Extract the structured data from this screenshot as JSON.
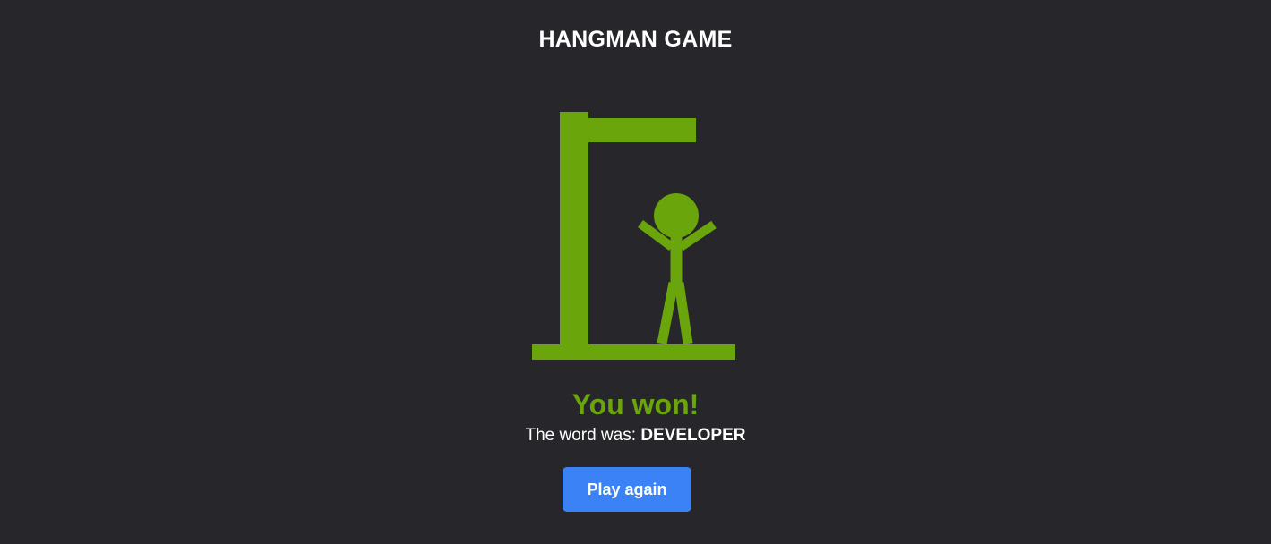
{
  "header": {
    "title": "HANGMAN GAME"
  },
  "game": {
    "status_text": "You won!",
    "word_prefix": "The word was: ",
    "word": "DEVELOPER",
    "wrong_guesses": 6,
    "max_wrong_guesses": 6
  },
  "actions": {
    "play_again_label": "Play again"
  },
  "colors": {
    "background": "#27262b",
    "accent_green": "#6aa50b",
    "button_blue": "#3b82f6",
    "text": "#ffffff"
  },
  "icons": {
    "gallows": "gallows-figure",
    "stick_figure": "stick-figure"
  }
}
